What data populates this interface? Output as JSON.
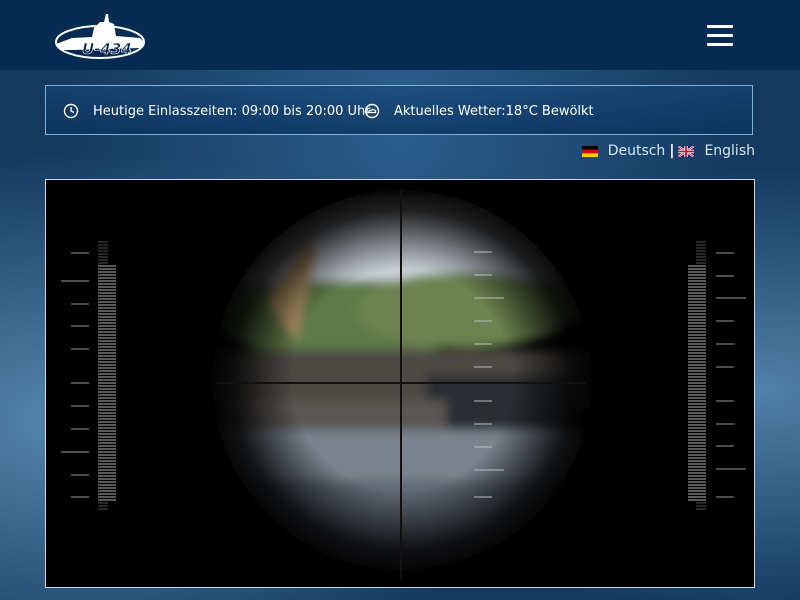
{
  "header": {
    "logo_text": "U-434",
    "menu_icon": "hamburger-menu-icon"
  },
  "info_bar": {
    "hours_icon": "clock-icon",
    "hours_text": "Heutige Einlasszeiten: 09:00 bis 20:00 Uhr",
    "weather_icon": "weather-icon",
    "weather_text": "Aktuelles Wetter:18°C Bewölkt"
  },
  "language": {
    "german_label": "Deutsch",
    "separator": "|",
    "english_label": "English"
  },
  "colors": {
    "header_bg": "#062b52",
    "text": "#ffffff",
    "accent": "#7fb0d6"
  }
}
